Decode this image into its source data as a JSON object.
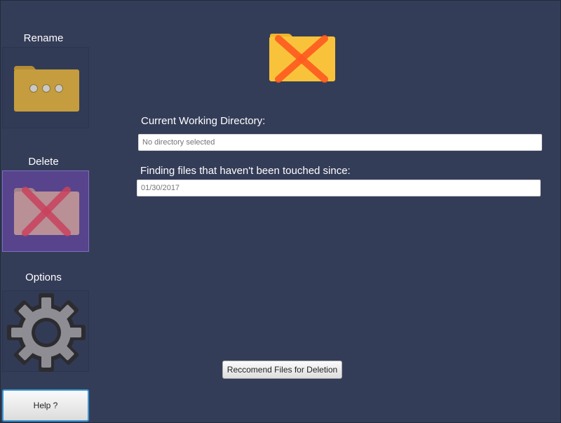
{
  "sidebar": {
    "rename": {
      "label": "Rename",
      "icon": "folder-dots-icon"
    },
    "delete": {
      "label": "Delete",
      "icon": "folder-delete-icon"
    },
    "options": {
      "label": "Options",
      "icon": "gear-icon"
    },
    "help_label": "Help ?"
  },
  "main": {
    "icon": "folder-delete-icon",
    "directory": {
      "label": "Current Working Directory:",
      "placeholder": "No directory selected"
    },
    "date": {
      "label": "Finding files that haven't been touched since:",
      "placeholder": "01/30/2017"
    },
    "recommend_label": "Reccomend Files for Deletion"
  },
  "colors": {
    "background": "#343d58",
    "active_tile": "#57448c",
    "folder_gold": "#c59d3e",
    "folder_yellow": "#f6c33a",
    "x_orange": "#ff5a1f"
  }
}
